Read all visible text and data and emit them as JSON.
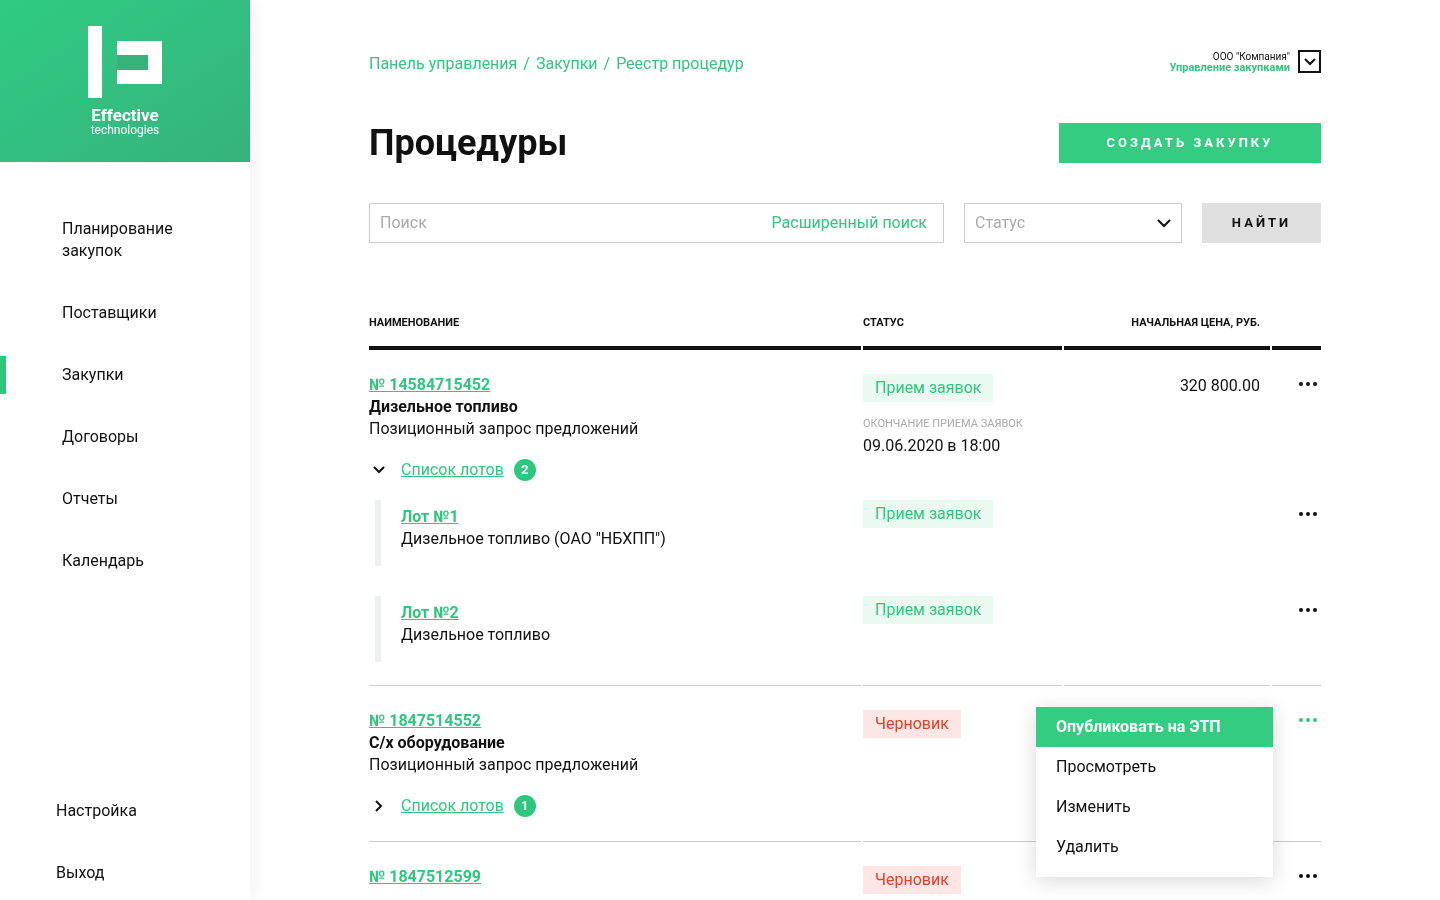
{
  "logo": {
    "name": "Effective",
    "tagline": "technologies"
  },
  "sidebar": {
    "items": [
      {
        "label": "Планирование закупок",
        "selected": false
      },
      {
        "label": "Поставщики",
        "selected": false
      },
      {
        "label": "Закупки",
        "selected": true
      },
      {
        "label": "Договоры",
        "selected": false
      },
      {
        "label": "Отчеты",
        "selected": false
      },
      {
        "label": "Календарь",
        "selected": false
      }
    ],
    "bottom_items": [
      {
        "label": "Настройка"
      },
      {
        "label": "Выход"
      }
    ]
  },
  "breadcrumbs": [
    "Панель управления",
    "Закупки",
    "Реестр процедур"
  ],
  "breadcrumb_separator": "/",
  "account": {
    "company": "ООО \"Компания\"",
    "role": "Управление закупками"
  },
  "title": "Процедуры",
  "create_button": "СОЗДАТЬ ЗАКУПКУ",
  "search": {
    "placeholder": "Поиск",
    "advanced_link": "Расширенный поиск"
  },
  "status_filter": {
    "placeholder": "Статус"
  },
  "find_button": "НАЙТИ",
  "table": {
    "columns": [
      "НАИМЕНОВАНИЕ",
      "СТАТУС",
      "НАЧАЛЬНАЯ ЦЕНА, РУБ."
    ],
    "rows": [
      {
        "number": "№ 14584715452",
        "name": "Дизельное топливо",
        "type": "Позиционный запрос предложений",
        "status": {
          "kind": "accepting",
          "label": "Прием заявок"
        },
        "deadline_label": "ОКОНЧАНИЕ ПРИЕМА ЗАЯВОК",
        "deadline": "09.06.2020 в 18:00",
        "price": "320 800.00",
        "lots_link": "Список лотов",
        "lots_count": "2",
        "expanded": true,
        "lots": [
          {
            "number": "Лот №1",
            "name": "Дизельное топливо (ОАО \"НБХПП\")",
            "status": {
              "kind": "accepting",
              "label": "Прием заявок"
            }
          },
          {
            "number": "Лот №2",
            "name": "Дизельное топливо",
            "status": {
              "kind": "accepting",
              "label": "Прием заявок"
            }
          }
        ]
      },
      {
        "number": "№ 1847514552",
        "name": "С/х оборудование",
        "type": "Позиционный запрос предложений",
        "status": {
          "kind": "draft",
          "label": "Черновик"
        },
        "lots_link": "Список лотов",
        "lots_count": "1",
        "expanded": false,
        "menu_open": true
      },
      {
        "number": "№ 1847512599",
        "status": {
          "kind": "draft",
          "label": "Черновик"
        }
      }
    ]
  },
  "context_menu": [
    {
      "label": "Опубликовать на ЭТП",
      "selected": true
    },
    {
      "label": "Просмотреть",
      "selected": false
    },
    {
      "label": "Изменить",
      "selected": false
    },
    {
      "label": "Удалить",
      "selected": false
    }
  ]
}
